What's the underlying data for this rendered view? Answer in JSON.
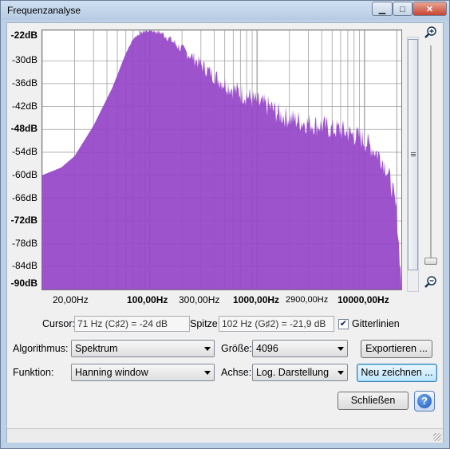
{
  "window": {
    "title": "Frequenzanalyse",
    "controls": {
      "minimize": "▁",
      "maximize": "□",
      "close": "✕"
    }
  },
  "plot": {
    "fill_color": "#9646c8",
    "grid_color": "#a0a0a0",
    "y_labels": [
      "-22dB",
      "-30dB",
      "-36dB",
      "-42dB",
      "-48dB",
      "-54dB",
      "-60dB",
      "-66dB",
      "-72dB",
      "-78dB",
      "-84dB",
      "-90dB"
    ],
    "x_labels": [
      "20,00Hz",
      "100,00Hz",
      "300,00Hz",
      "1000,00Hz",
      "2900,00Hz",
      "10000,00Hz"
    ],
    "zoom_in_icon": "zoom-in-icon",
    "zoom_out_icon": "zoom-out-icon"
  },
  "chart_data": {
    "type": "area",
    "x_scale": "log",
    "xlim_hz": [
      10,
      22050
    ],
    "ylim_db": [
      -90,
      -22
    ],
    "y_ticks_db": [
      -22,
      -30,
      -36,
      -42,
      -48,
      -54,
      -60,
      -66,
      -72,
      -78,
      -84,
      -90
    ],
    "x_ticks_hz": [
      20,
      100,
      300,
      1000,
      2900,
      10000
    ],
    "grid": true,
    "series": [
      {
        "x_hz": [
          10,
          15,
          20,
          30,
          45,
          60,
          71,
          85,
          102,
          125,
          150,
          200,
          250,
          300,
          400,
          500,
          650,
          800,
          1000,
          1300,
          1600,
          2000,
          2600,
          3200,
          4000,
          5000,
          6000,
          7000,
          8000,
          9000,
          10000,
          12000,
          14000,
          16000,
          18000,
          20000,
          22050
        ],
        "y_db": [
          -60,
          -58,
          -55,
          -47,
          -37,
          -28,
          -24,
          -22.5,
          -21.9,
          -22.5,
          -24,
          -27,
          -29,
          -31,
          -34,
          -36,
          -38,
          -39,
          -41,
          -42,
          -44,
          -45,
          -46,
          -46.5,
          -47,
          -48,
          -48,
          -49,
          -49.5,
          -50,
          -51,
          -53,
          -55,
          -58,
          -63,
          -70,
          -88
        ]
      }
    ],
    "cursor_hz": 71,
    "peak_hz": 102
  },
  "controls": {
    "cursor_label": "Cursor:",
    "cursor_value": "71 Hz (C♯2) = -24 dB",
    "peak_label": "Spitze:",
    "peak_value": "102 Hz (G♯2) = -21,9 dB",
    "gridlines_label": "Gitterlinien",
    "gridlines_checked": true,
    "algorithm_label": "Algorithmus:",
    "algorithm_value": "Spektrum",
    "size_label": "Größe:",
    "size_value": "4096",
    "export_button": "Exportieren ...",
    "function_label": "Funktion:",
    "function_value": "Hanning window",
    "axis_label": "Achse:",
    "axis_value": "Log. Darstellung",
    "replot_button": "Neu zeichnen ...",
    "close_button": "Schließen",
    "help_icon": "help-icon"
  }
}
